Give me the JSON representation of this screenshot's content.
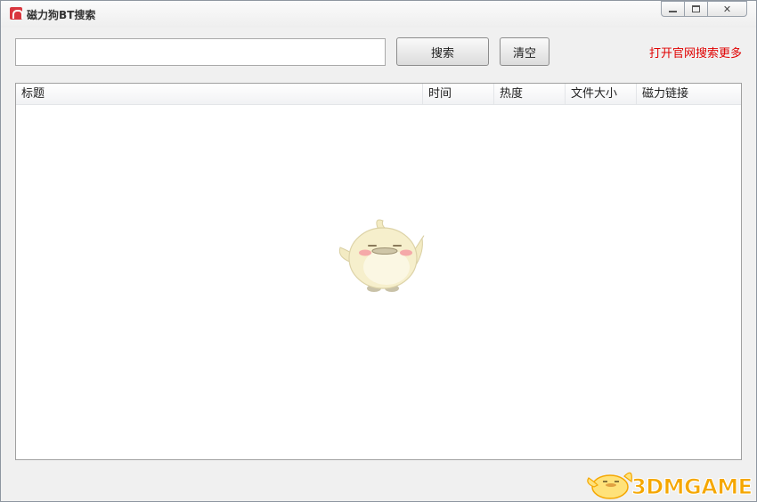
{
  "window": {
    "title": "磁力狗BT搜索",
    "icon": "magnet-icon",
    "controls": [
      "minimize-icon",
      "maximize-icon",
      "close-icon"
    ],
    "close_glyph": "✕"
  },
  "search": {
    "value": "",
    "placeholder": ""
  },
  "buttons": {
    "search_label": "搜索",
    "clear_label": "清空"
  },
  "link": {
    "more_label": "打开官网搜索更多"
  },
  "table": {
    "columns": [
      "标题",
      "时间",
      "热度",
      "文件大小",
      "磁力链接"
    ],
    "rows": []
  },
  "watermark": {
    "text": "3DMGAME"
  },
  "colors": {
    "link": "#e00000",
    "watermark": "#f5a700",
    "accent_icon": "#d9363e"
  }
}
